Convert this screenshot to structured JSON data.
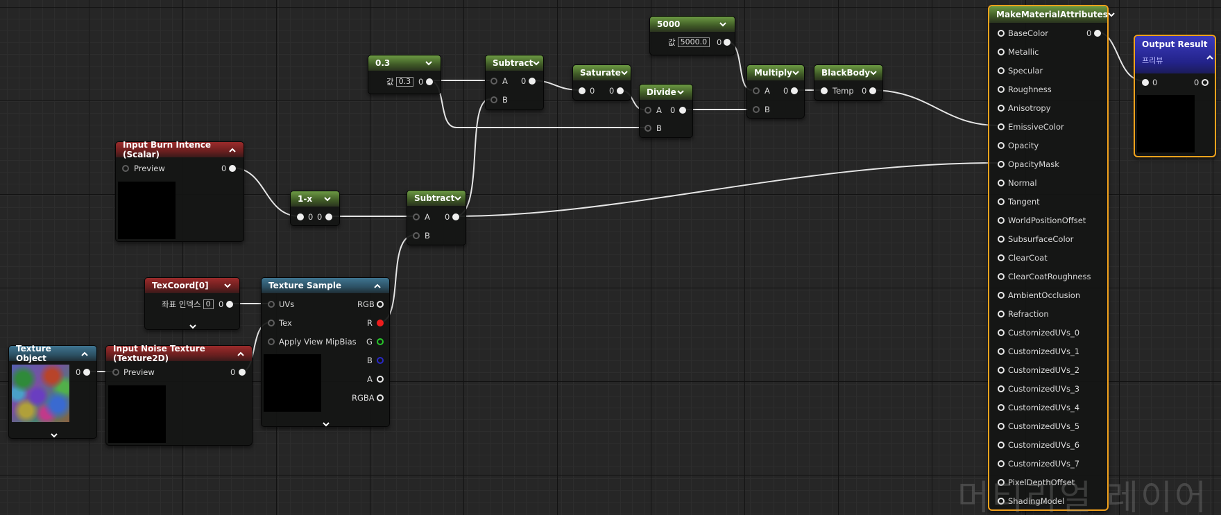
{
  "nodes": {
    "c03": {
      "title": "0.3",
      "value_label": "값",
      "value": "0.3",
      "out": "0"
    },
    "sub1": {
      "title": "Subtract",
      "a": "A",
      "b": "B",
      "out": "0"
    },
    "sat": {
      "title": "Saturate",
      "in": "0",
      "out": "0"
    },
    "div": {
      "title": "Divide",
      "a": "A",
      "b": "B",
      "out": "0"
    },
    "c5000": {
      "title": "5000",
      "value_label": "값",
      "value": "5000.0",
      "out": "0"
    },
    "mul": {
      "title": "Multiply",
      "a": "A",
      "b": "B",
      "out": "0"
    },
    "bb": {
      "title": "BlackBody",
      "temp": "Temp",
      "out": "0"
    },
    "burn": {
      "title": "Input Burn Intence (Scalar)",
      "preview": "Preview",
      "out": "0"
    },
    "omx": {
      "title": "1-x",
      "in": "0",
      "out": "0"
    },
    "sub2": {
      "title": "Subtract",
      "a": "A",
      "b": "B",
      "out": "0"
    },
    "texc": {
      "title": "TexCoord[0]",
      "label": "좌표 인덱스",
      "value": "0",
      "out": "0"
    },
    "tsamp": {
      "title": "Texture Sample",
      "uvs": "UVs",
      "tex": "Tex",
      "mip": "Apply View MipBias",
      "rgb": "RGB",
      "r": "R",
      "g": "G",
      "b": "B",
      "a": "A",
      "rgba": "RGBA"
    },
    "tobj": {
      "title": "Texture Object",
      "out": "0"
    },
    "noise": {
      "title": "Input Noise Texture (Texture2D)",
      "preview": "Preview",
      "out": "0"
    },
    "mma": {
      "title": "MakeMaterialAttributes",
      "out": "0",
      "pins": [
        "BaseColor",
        "Metallic",
        "Specular",
        "Roughness",
        "Anisotropy",
        "EmissiveColor",
        "Opacity",
        "OpacityMask",
        "Normal",
        "Tangent",
        "WorldPositionOffset",
        "SubsurfaceColor",
        "ClearCoat",
        "ClearCoatRoughness",
        "AmbientOcclusion",
        "Refraction",
        "CustomizedUVs_0",
        "CustomizedUVs_1",
        "CustomizedUVs_2",
        "CustomizedUVs_3",
        "CustomizedUVs_4",
        "CustomizedUVs_5",
        "CustomizedUVs_6",
        "CustomizedUVs_7",
        "PixelDepthOffset",
        "ShadingModel"
      ]
    },
    "out": {
      "title": "Output Result",
      "subtitle": "프리뷰",
      "in": "0",
      "out": "0"
    }
  },
  "watermark": "머티리얼 레이어",
  "colors": {
    "constant_header": "#5d8a38",
    "parameter_header": "#8e2a2a",
    "texture_header": "#346a86",
    "output_header": "#2f2fa8",
    "selection": "#f3a21c",
    "r_pin": "#ee1d1d",
    "g_pin": "#27c62a",
    "b_pin": "#2929c8"
  },
  "icons": {
    "collapse": "chevron-down-icon",
    "expand": "chevron-up-icon"
  }
}
